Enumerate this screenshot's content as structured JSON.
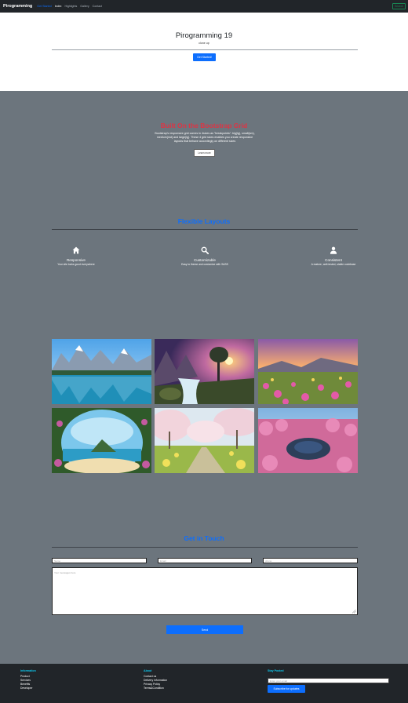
{
  "navbar": {
    "brand": "Pirogramming",
    "links": [
      "Get Started",
      "Index",
      "Highlights",
      "Gallery",
      "Contact"
    ],
    "action_button": "Search"
  },
  "hero": {
    "title": "Pirogramming 19",
    "subtitle": "clone up",
    "button": "Get Started!"
  },
  "grid_intro": {
    "title": "Built On the Bootstrap Grid",
    "description": "Bootstrap's responsive grid comes in 4sizes as \"breakpoints\": big(lg), small(sm), medium(md) and large(lg). These 4 grid sizes enables you create responsive layouts that behave accordingly on different sizes",
    "button": "Learn more"
  },
  "features": {
    "title": "Flexible Layouts",
    "items": [
      {
        "icon": "home-icon",
        "title": "Responsive",
        "desc": "Your site looks good everywhere"
      },
      {
        "icon": "search-icon",
        "title": "Customizable",
        "desc": "Easy to theme and customize with SASS"
      },
      {
        "icon": "person-icon",
        "title": "Consistent",
        "desc": "A mature, well-tested, stable codebase"
      }
    ]
  },
  "gallery": {
    "images": [
      "lake-mountains",
      "waterfall-sunset",
      "flower-field-sunset",
      "cave-island-beach",
      "cherry-blossom-road",
      "pink-forest-lake"
    ]
  },
  "contact": {
    "title": "Get in Touch",
    "name_placeholder": "Name",
    "email_placeholder": "Email",
    "phone_placeholder": "phone",
    "message_placeholder": "Your messages here",
    "send_button": "Send"
  },
  "footer": {
    "information": {
      "heading": "Information",
      "items": [
        "Product",
        "Services",
        "Benefits",
        "Developer"
      ]
    },
    "about": {
      "heading": "About",
      "items": [
        "Contact us",
        "Delivery Information",
        "Privacy Policy",
        "Terms&Condition"
      ]
    },
    "stay_posted": {
      "heading": "Stay Posted",
      "email_placeholder": "Enter your email",
      "button": "Subscribe for updates"
    }
  },
  "colors": {
    "navbar_bg": "#212529",
    "page_bg": "#6c757d",
    "primary": "#0d6efd",
    "danger": "#dc3545",
    "info": "#0dcaf0",
    "success": "#198754"
  }
}
